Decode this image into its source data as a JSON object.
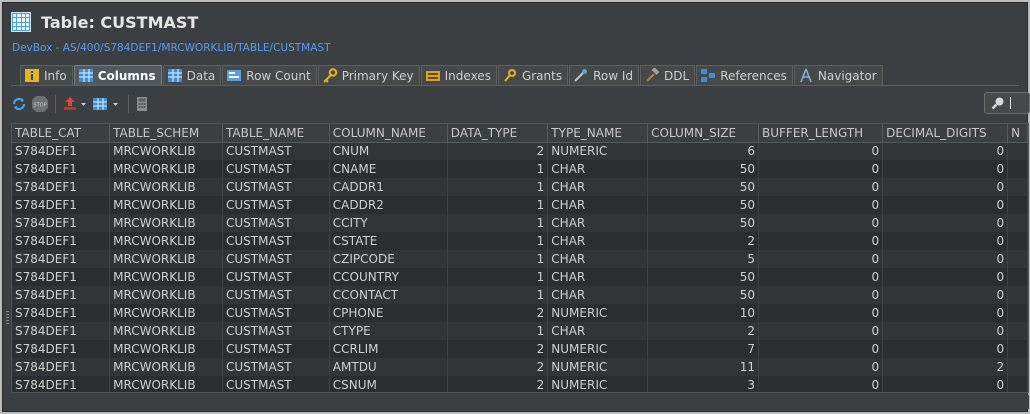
{
  "window": {
    "title": "Table: CUSTMAST",
    "path": "DevBox - AS/400/S784DEF1/MRCWORKLIB/TABLE/CUSTMAST"
  },
  "tabs": [
    {
      "label": "Info",
      "icon": "info-icon"
    },
    {
      "label": "Columns",
      "icon": "columns-icon",
      "active": true
    },
    {
      "label": "Data",
      "icon": "data-grid-icon"
    },
    {
      "label": "Row Count",
      "icon": "row-count-icon"
    },
    {
      "label": "Primary Key",
      "icon": "key-icon"
    },
    {
      "label": "Indexes",
      "icon": "index-icon"
    },
    {
      "label": "Grants",
      "icon": "grants-icon"
    },
    {
      "label": "Row Id",
      "icon": "row-id-icon"
    },
    {
      "label": "DDL",
      "icon": "hammer-icon"
    },
    {
      "label": "References",
      "icon": "references-icon"
    },
    {
      "label": "Navigator",
      "icon": "navigator-icon"
    }
  ],
  "toolbar": {
    "refresh": "refresh-icon",
    "stop": "STOP",
    "export": "export-icon",
    "grid_view": "grid-view-icon",
    "calculator": "calculator-icon"
  },
  "search": {
    "placeholder": "",
    "value": ""
  },
  "table": {
    "columns": [
      "TABLE_CAT",
      "TABLE_SCHEM",
      "TABLE_NAME",
      "COLUMN_NAME",
      "DATA_TYPE",
      "TYPE_NAME",
      "COLUMN_SIZE",
      "BUFFER_LENGTH",
      "DECIMAL_DIGITS",
      "N"
    ],
    "rows": [
      [
        "S784DEF1",
        "MRCWORKLIB",
        "CUSTMAST",
        "CNUM",
        "2",
        "NUMERIC",
        "6",
        "0",
        "0"
      ],
      [
        "S784DEF1",
        "MRCWORKLIB",
        "CUSTMAST",
        "CNAME",
        "1",
        "CHAR",
        "50",
        "0",
        "0"
      ],
      [
        "S784DEF1",
        "MRCWORKLIB",
        "CUSTMAST",
        "CADDR1",
        "1",
        "CHAR",
        "50",
        "0",
        "0"
      ],
      [
        "S784DEF1",
        "MRCWORKLIB",
        "CUSTMAST",
        "CADDR2",
        "1",
        "CHAR",
        "50",
        "0",
        "0"
      ],
      [
        "S784DEF1",
        "MRCWORKLIB",
        "CUSTMAST",
        "CCITY",
        "1",
        "CHAR",
        "50",
        "0",
        "0"
      ],
      [
        "S784DEF1",
        "MRCWORKLIB",
        "CUSTMAST",
        "CSTATE",
        "1",
        "CHAR",
        "2",
        "0",
        "0"
      ],
      [
        "S784DEF1",
        "MRCWORKLIB",
        "CUSTMAST",
        "CZIPCODE",
        "1",
        "CHAR",
        "5",
        "0",
        "0"
      ],
      [
        "S784DEF1",
        "MRCWORKLIB",
        "CUSTMAST",
        "CCOUNTRY",
        "1",
        "CHAR",
        "50",
        "0",
        "0"
      ],
      [
        "S784DEF1",
        "MRCWORKLIB",
        "CUSTMAST",
        "CCONTACT",
        "1",
        "CHAR",
        "50",
        "0",
        "0"
      ],
      [
        "S784DEF1",
        "MRCWORKLIB",
        "CUSTMAST",
        "CPHONE",
        "2",
        "NUMERIC",
        "10",
        "0",
        "0"
      ],
      [
        "S784DEF1",
        "MRCWORKLIB",
        "CUSTMAST",
        "CTYPE",
        "1",
        "CHAR",
        "2",
        "0",
        "0"
      ],
      [
        "S784DEF1",
        "MRCWORKLIB",
        "CUSTMAST",
        "CCRLIM",
        "2",
        "NUMERIC",
        "7",
        "0",
        "0"
      ],
      [
        "S784DEF1",
        "MRCWORKLIB",
        "CUSTMAST",
        "AMTDU",
        "2",
        "NUMERIC",
        "11",
        "0",
        "2"
      ],
      [
        "S784DEF1",
        "MRCWORKLIB",
        "CUSTMAST",
        "CSNUM",
        "2",
        "NUMERIC",
        "3",
        "0",
        "0"
      ]
    ]
  },
  "colors": {
    "background": "#3c3f41",
    "path_link": "#589df6",
    "title_icon": "#4a9fe0"
  }
}
